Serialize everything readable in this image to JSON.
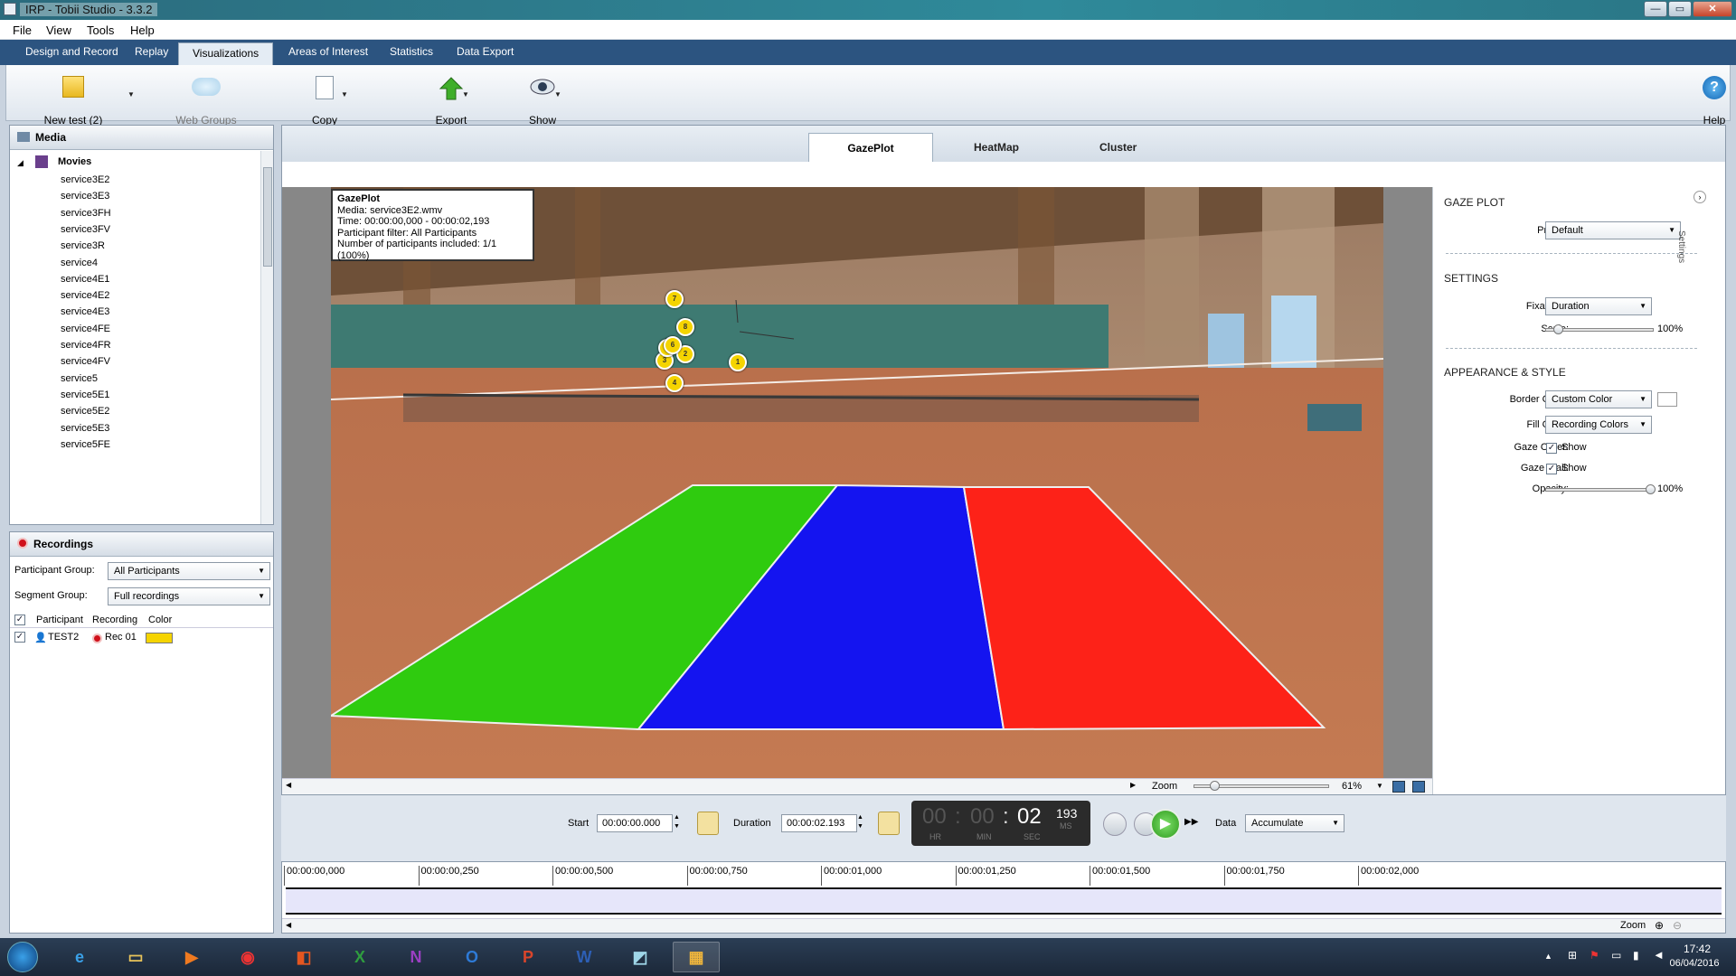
{
  "window": {
    "title": "IRP - Tobii Studio - 3.3.2",
    "min": "—",
    "max": "▭",
    "close": "✕"
  },
  "menu": [
    "File",
    "View",
    "Tools",
    "Help"
  ],
  "main_tabs": [
    "Design and Record",
    "Replay",
    "Visualizations",
    "Areas of Interest",
    "Statistics",
    "Data Export"
  ],
  "toolbar": {
    "new_test": "New test (2)",
    "web_groups": "Web Groups",
    "copy": "Copy",
    "export": "Export",
    "show": "Show",
    "help": "Help"
  },
  "media_panel": {
    "title": "Media",
    "root": "Movies",
    "items": [
      "service3E2",
      "service3E3",
      "service3FH",
      "service3FV",
      "service3R",
      "service4",
      "service4E1",
      "service4E2",
      "service4E3",
      "service4FE",
      "service4FR",
      "service4FV",
      "service5",
      "service5E1",
      "service5E2",
      "service5E3",
      "service5FE"
    ]
  },
  "recordings": {
    "title": "Recordings",
    "participant_group_label": "Participant Group:",
    "participant_group": "All Participants",
    "segment_group_label": "Segment Group:",
    "segment_group": "Full recordings",
    "columns": [
      "Participant",
      "Recording",
      "Color"
    ],
    "row": {
      "participant": "TEST2",
      "recording": "Rec 01",
      "color": "#f5d400"
    }
  },
  "view_tabs": [
    "GazePlot",
    "HeatMap",
    "Cluster"
  ],
  "info_box": {
    "title": "GazePlot",
    "media": "Media: service3E2.wmv",
    "time": "Time: 00:00:00,000 - 00:00:02,193",
    "filter": "Participant filter: All Participants",
    "count": "Number of participants included: 1/1 (100%)"
  },
  "fixations": [
    "1",
    "2",
    "3",
    "4",
    "5",
    "6",
    "7",
    "8"
  ],
  "zones": {
    "green": "#2fcb0f",
    "blue": "#1414f0",
    "red": "#fd2218"
  },
  "zoom": {
    "label": "Zoom",
    "value": "61%"
  },
  "gaze_settings": {
    "section1": "GAZE PLOT",
    "preset_label": "Preset:",
    "preset": "Default",
    "section2": "SETTINGS",
    "fixations_label": "Fixations:",
    "fixations": "Duration",
    "scale_label": "Scale:",
    "scale": "100%",
    "section3": "APPEARANCE & STYLE",
    "border_label": "Border Color:",
    "border": "Custom Color",
    "fill_label": "Fill Color:",
    "fill": "Recording Colors",
    "gaze_order_label": "Gaze Order:",
    "gaze_trail_label": "Gaze Trail:",
    "show": "Show",
    "opacity_label": "Opacity:",
    "opacity": "100%",
    "side_tab": "Settings"
  },
  "playback": {
    "start_label": "Start",
    "start": "00:00:00.000",
    "duration_label": "Duration",
    "duration": "00:00:02.193",
    "hr": "00",
    "min": "00",
    "sec": "02",
    "ms": "193",
    "hr_label": "HR",
    "min_label": "MIN",
    "sec_label": "SEC",
    "ms_label": "MS",
    "data_label": "Data",
    "data": "Accumulate"
  },
  "timeline": {
    "ticks": [
      "00:00:00,000",
      "00:00:00,250",
      "00:00:00,500",
      "00:00:00,750",
      "00:00:01,000",
      "00:00:01,250",
      "00:00:01,500",
      "00:00:01,750",
      "00:00:02,000"
    ],
    "zoom": "Zoom"
  },
  "taskbar": {
    "time": "17:42",
    "date": "06/04/2016"
  }
}
